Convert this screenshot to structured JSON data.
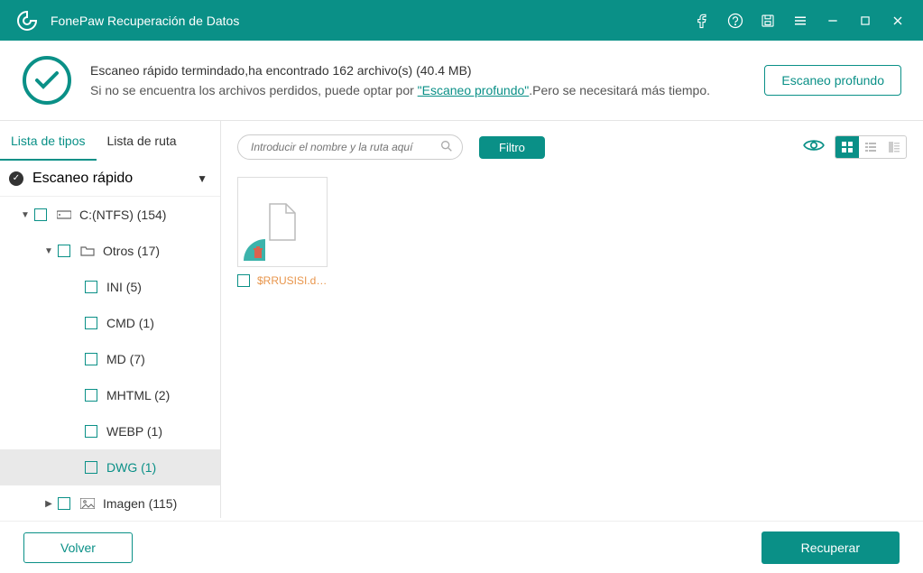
{
  "app": {
    "title": "FonePaw Recuperación de Datos"
  },
  "status": {
    "line1": "Escaneo rápido termindado,ha encontrado 162 archivo(s) (40.4 MB)",
    "line2a": "Si no se encuentra los archivos perdidos, puede optar por ",
    "deep_link": "\"Escaneo profundo\"",
    "line2b": ".Pero se necesitará más tiempo.",
    "deep_button": "Escaneo profundo"
  },
  "sidebar": {
    "tabs": {
      "types": "Lista de tipos",
      "path": "Lista de ruta"
    },
    "scan_header": "Escaneo rápido",
    "tree": {
      "drive": "C:(NTFS) (154)",
      "otros": "Otros (17)",
      "ini": "INI (5)",
      "cmd": "CMD (1)",
      "md": "MD (7)",
      "mhtml": "MHTML (2)",
      "webp": "WEBP (1)",
      "dwg": "DWG (1)",
      "imagen": "Imagen (115)"
    }
  },
  "toolbar": {
    "search_placeholder": "Introducir el nombre y la ruta aquí",
    "filter": "Filtro"
  },
  "files": [
    {
      "name": "$RRUSISI.dwg"
    }
  ],
  "footer": {
    "back": "Volver",
    "recover": "Recuperar"
  },
  "colors": {
    "accent": "#0a9087",
    "file_deleted": "#e8954b"
  }
}
